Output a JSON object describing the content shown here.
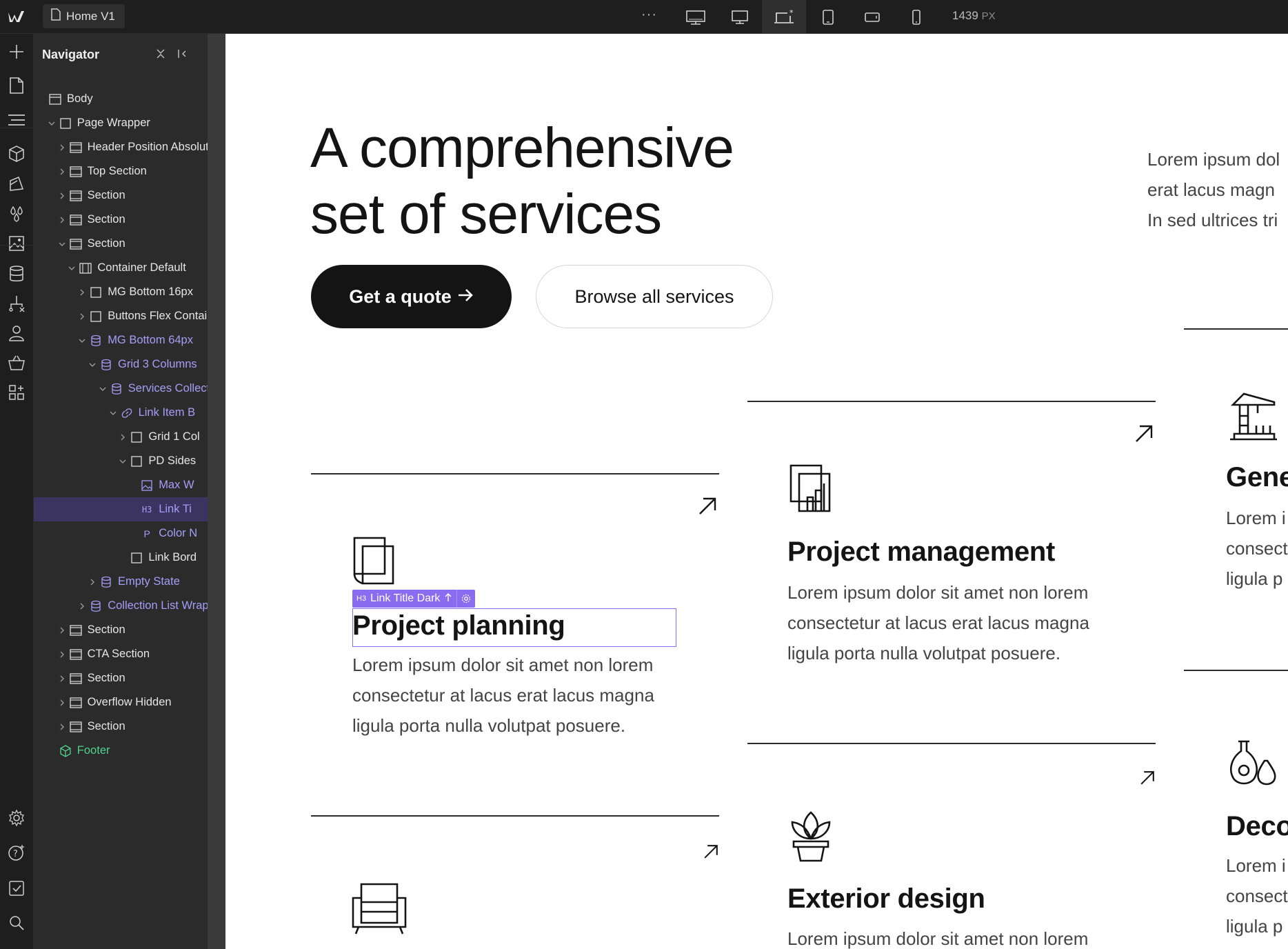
{
  "topbar": {
    "page_name": "Home V1",
    "more_label": "···",
    "width_value": "1439",
    "width_unit": "PX",
    "breakpoints": [
      "desktop-large-icon",
      "desktop-icon",
      "desktop-base-icon",
      "tablet-icon",
      "mobile-landscape-icon",
      "mobile-portrait-icon"
    ],
    "active_breakpoint": 2
  },
  "navigator": {
    "title": "Navigator",
    "items": [
      {
        "label": "Body"
      },
      {
        "label": "Page Wrapper"
      },
      {
        "label": "Header Position Absolute"
      },
      {
        "label": "Top Section"
      },
      {
        "label": "Section"
      },
      {
        "label": "Section"
      },
      {
        "label": "Section"
      },
      {
        "label": "Container Default"
      },
      {
        "label": "MG Bottom 16px"
      },
      {
        "label": "Buttons Flex Container"
      },
      {
        "label": "MG Bottom 64px"
      },
      {
        "label": "Grid 3 Columns"
      },
      {
        "label": "Services Collection"
      },
      {
        "label": "Link Item B"
      },
      {
        "label": "Grid 1 Col"
      },
      {
        "label": "PD Sides"
      },
      {
        "label": "Max W"
      },
      {
        "label": "Link Ti"
      },
      {
        "label": "Color N"
      },
      {
        "label": "Link Bord"
      },
      {
        "label": "Empty State"
      },
      {
        "label": "Collection List Wrapper"
      },
      {
        "label": "Section"
      },
      {
        "label": "CTA Section"
      },
      {
        "label": "Section"
      },
      {
        "label": "Overflow Hidden"
      },
      {
        "label": "Section"
      },
      {
        "label": "Footer"
      }
    ],
    "tag_h3": "H3",
    "tag_p": "P"
  },
  "canvas": {
    "hero_title_line1": "A comprehensive",
    "hero_title_line2": "set of services",
    "primary_button": "Get a quote",
    "secondary_button": "Browse all services",
    "intro_line1": "Lorem ipsum dol",
    "intro_line2": "erat lacus magn",
    "intro_line3": "In sed ultrices tri",
    "selection_tag": "H3",
    "selection_label": "Link Title Dark",
    "services": [
      {
        "title": "Project planning",
        "desc1": "Lorem ipsum dolor sit amet non lorem",
        "desc2": "consectetur at lacus erat lacus magna",
        "desc3": "ligula porta nulla volutpat posuere."
      },
      {
        "title": "Project management",
        "desc1": "Lorem ipsum dolor sit amet non lorem",
        "desc2": "consectetur at lacus erat lacus magna",
        "desc3": "ligula porta nulla volutpat posuere."
      },
      {
        "title": "Gene",
        "desc1": "Lorem i",
        "desc2": "consect",
        "desc3": "ligula p"
      },
      {
        "title": "Exterior design",
        "desc1": "Lorem ipsum dolor sit amet non lorem"
      },
      {
        "title": "Deco",
        "desc1": "Lorem i",
        "desc2": "consect",
        "desc3": "ligula p"
      }
    ]
  },
  "colors": {
    "selection": "#8a6cf0",
    "symbol": "#a99cf7",
    "component": "#4ed38b",
    "dark": "#141414"
  }
}
